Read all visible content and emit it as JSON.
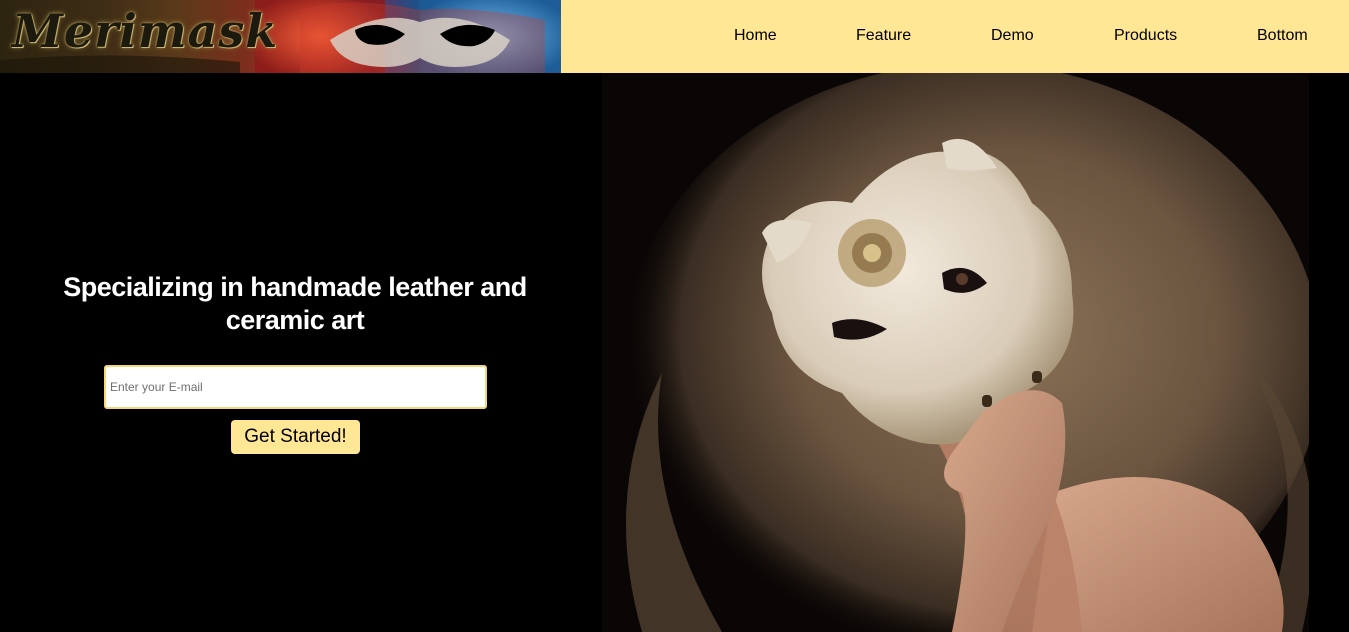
{
  "header": {
    "logo_text": "Merimask",
    "nav": [
      {
        "label": "Home"
      },
      {
        "label": "Feature"
      },
      {
        "label": "Demo"
      },
      {
        "label": "Products"
      },
      {
        "label": "Bottom"
      }
    ]
  },
  "hero": {
    "tagline": "Specializing in handmade leather and ceramic art",
    "email_placeholder": "Enter your E-mail",
    "email_value": "",
    "cta_label": "Get Started!"
  },
  "colors": {
    "header_bg": "#ffe795",
    "page_bg": "#000000",
    "button_bg": "#ffe795",
    "input_border": "#f3d77a"
  }
}
